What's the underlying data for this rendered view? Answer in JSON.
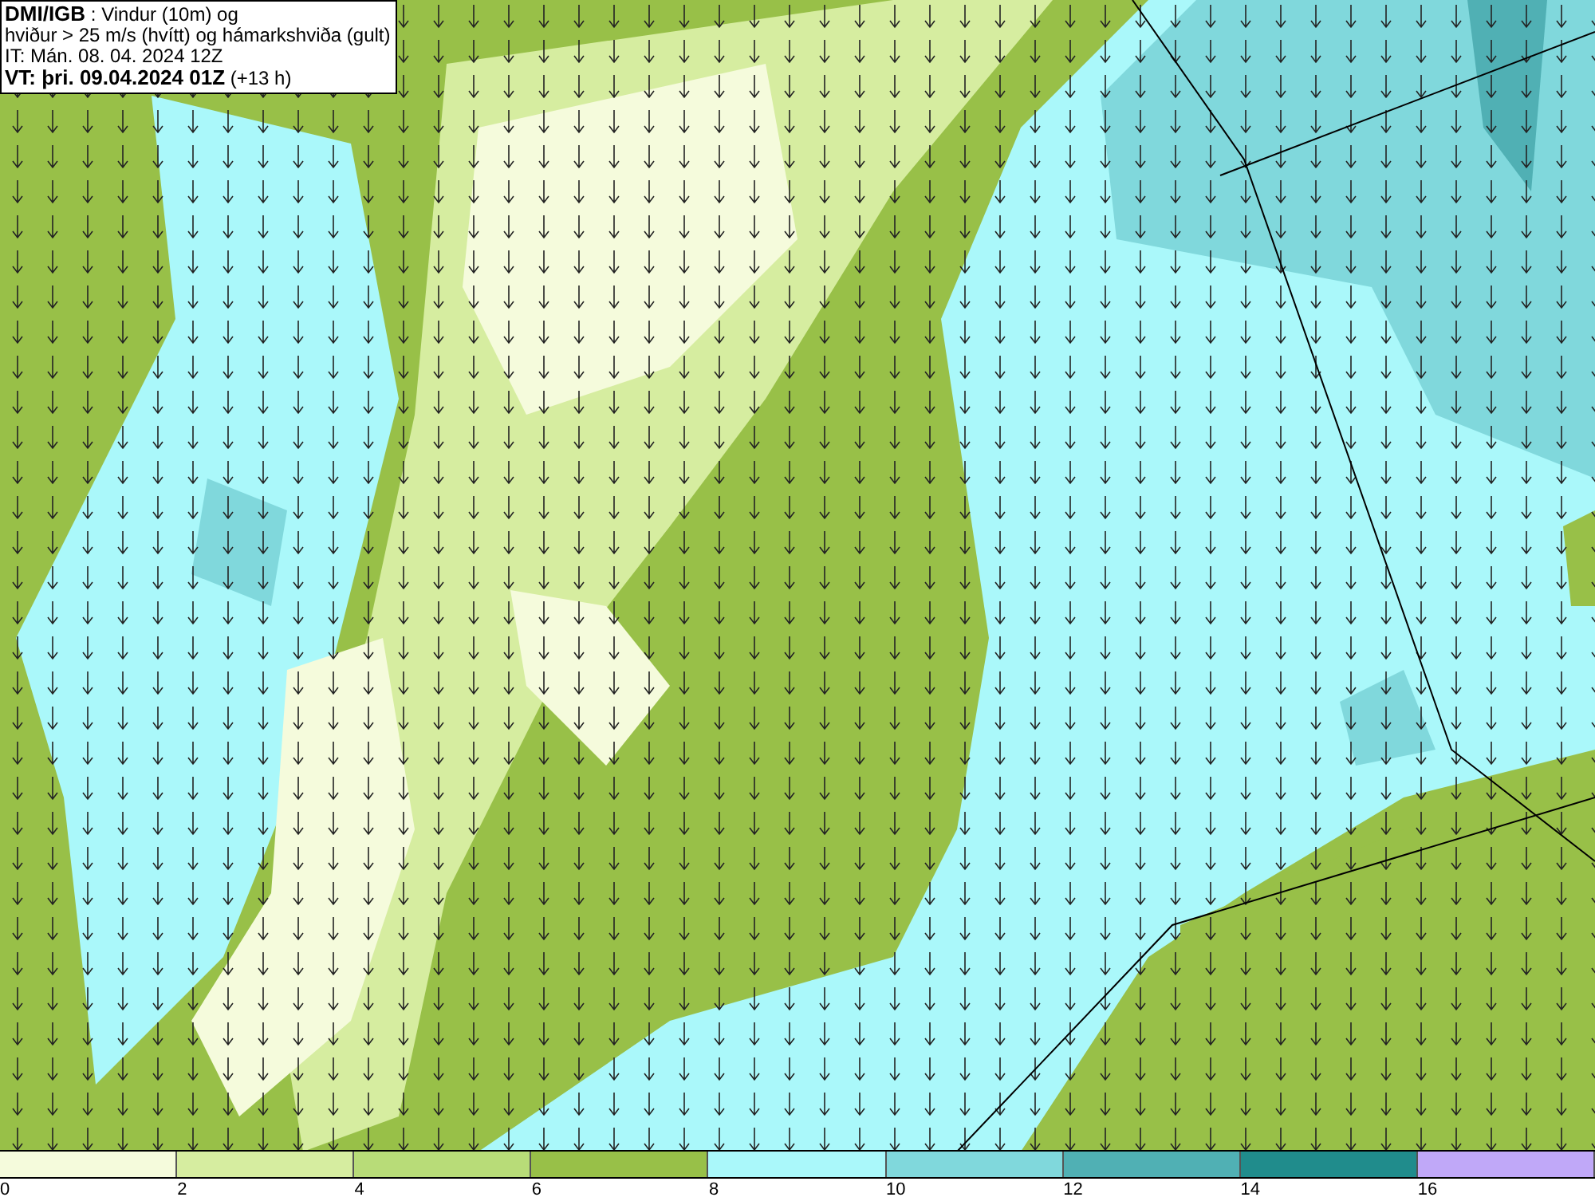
{
  "title_box": {
    "lines": [
      "**DMI/IGB** : Vindur (10m) og",
      "hviður > 25 m/s (hvítt) og hámarkshviða (gult)",
      "IT: Mán. 08. 04. 2024 12Z",
      "**VT: þri. 09.04.2024 01Z** (+13 h)"
    ]
  },
  "legend": {
    "swatches": [
      {
        "color": "#f5fbdc"
      },
      {
        "color": "#d6eda0"
      },
      {
        "color": "#b8dc78"
      },
      {
        "color": "#98c048"
      },
      {
        "color": "#aaf8fa"
      },
      {
        "color": "#80d8dc"
      },
      {
        "color": "#50b0b4"
      },
      {
        "color": "#208c8c"
      },
      {
        "color": "#c0a8f8"
      }
    ],
    "ticks": [
      "0",
      "2",
      "4",
      "6",
      "8",
      "10",
      "12",
      "14",
      "16"
    ]
  }
}
